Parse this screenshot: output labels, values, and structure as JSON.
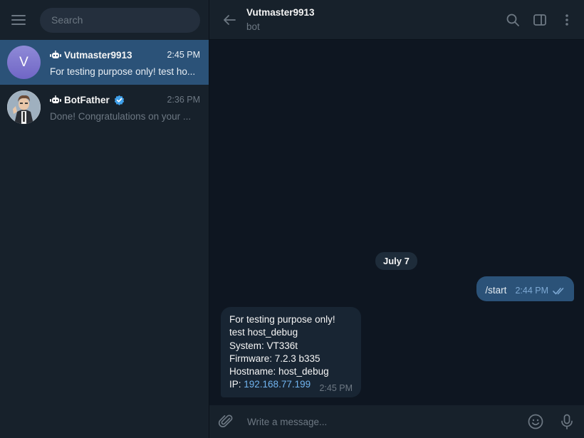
{
  "sidebar": {
    "search_placeholder": "Search",
    "chats": [
      {
        "name": "Vutmaster9913",
        "time": "2:45 PM",
        "preview": "For testing purpose only! test ho...",
        "avatar_letter": "V",
        "is_bot": true,
        "verified": false,
        "active": true
      },
      {
        "name": "BotFather",
        "time": "2:36 PM",
        "preview": "Done! Congratulations on your ...",
        "is_bot": true,
        "verified": true,
        "active": false
      }
    ]
  },
  "header": {
    "peer_name": "Vutmaster9913",
    "peer_status": "bot"
  },
  "messages": {
    "date_separator": "July 7",
    "outgoing": {
      "text": "/start",
      "time": "2:44 PM"
    },
    "incoming": {
      "lines": [
        "For testing purpose only!",
        "test host_debug",
        "System: VT336t",
        "Firmware: 7.2.3 b335",
        "Hostname: host_debug"
      ],
      "ip_label": "IP: ",
      "ip_link": "192.168.77.199",
      "time": "2:45 PM"
    }
  },
  "composer": {
    "placeholder": "Write a message..."
  },
  "colors": {
    "sidebar_bg": "#17212b",
    "chat_bg": "#0e1621",
    "active_item": "#2b5278",
    "outgoing_bubble": "#2b5278",
    "incoming_bubble": "#182533",
    "link": "#71b4ef",
    "muted": "#6d7883"
  }
}
